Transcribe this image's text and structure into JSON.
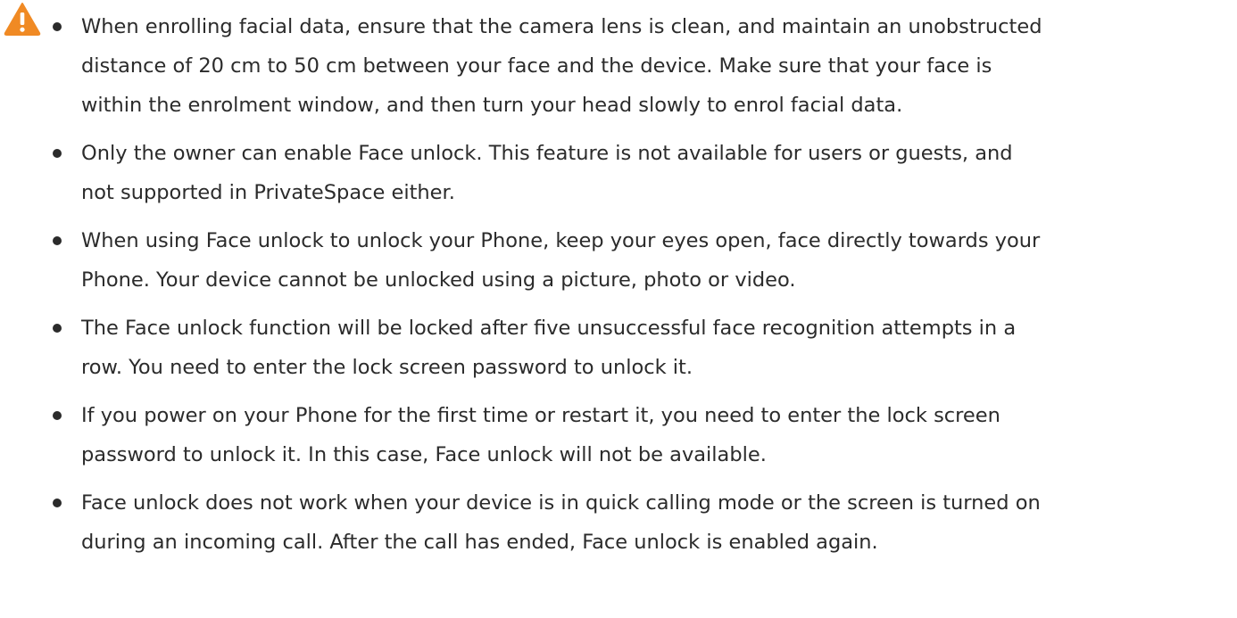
{
  "icons": {
    "warning": "warning-triangle-icon",
    "warning_color": "#f08a24"
  },
  "notes": [
    {
      "line1": "When enrolling facial data, ensure that the camera lens is clean, and maintain an unobstructed",
      "line2": "distance of 20 cm to 50 cm between your face and the device. Make sure that your face is",
      "line3": "within the enrolment window, and then turn your head slowly to enrol facial data."
    },
    {
      "line1": "Only the owner can enable Face unlock. This feature is not available for users or guests, and",
      "line2": "not supported in PrivateSpace either."
    },
    {
      "line1": "When using Face unlock to unlock your Phone, keep your eyes open, face directly towards your",
      "line2": "Phone. Your device cannot be unlocked using a picture, photo or video."
    },
    {
      "line1": "The Face unlock function will be locked after five unsuccessful face recognition attempts in a",
      "line2": "row. You need to enter the lock screen password to unlock it."
    },
    {
      "line1": "If you power on your Phone for the first time or restart it, you need to enter the lock screen",
      "line2": "password to unlock it. In this case, Face unlock will not be available."
    },
    {
      "line1": "Face unlock does not work when your device is in quick calling mode or the screen is turned on",
      "line2": "during an incoming call. After the call has ended, Face unlock is enabled again."
    }
  ]
}
